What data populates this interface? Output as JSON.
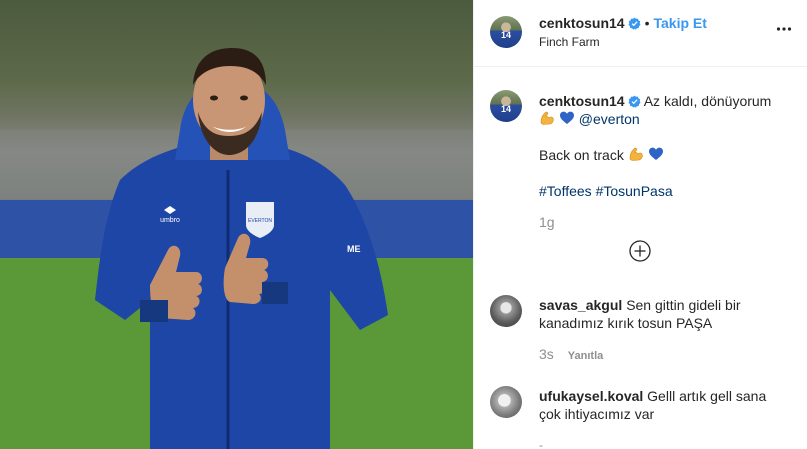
{
  "post": {
    "author": "cenktosun14",
    "follow_label": "Takip Et",
    "location": "Finch Farm",
    "caption_line1": "Az kaldı, dönüyorum",
    "caption_mention": "@everton",
    "caption_line2": "Back on track",
    "hashtag1": "#Toffees",
    "hashtag2": "#TosunPasa",
    "time_ago": "1g"
  },
  "photo": {
    "shirt_text": "umbro",
    "badge_text": "EVERTON",
    "sponsor_text": "ME"
  },
  "comments": [
    {
      "username": "savas_akgul",
      "text": "Sen gittin gideli bir kanadımız kırık tosun PAŞA",
      "time": "3s",
      "reply_label": "Yanıtla"
    },
    {
      "username": "ufukaysel.koval",
      "text": "Gelll artık gell sana çok ihtiyacımız var",
      "time": "-"
    }
  ],
  "colors": {
    "link": "#3897f0",
    "hashtag": "#003569",
    "verified": "#3897f0",
    "muted": "#8e8e8e",
    "heart": "#2f63c8"
  },
  "icons": {
    "verified": "verified-badge-icon",
    "more": "more-options-icon",
    "load_more": "plus-circle-icon",
    "muscle": "flexed-biceps-emoji",
    "heart": "blue-heart-emoji"
  }
}
